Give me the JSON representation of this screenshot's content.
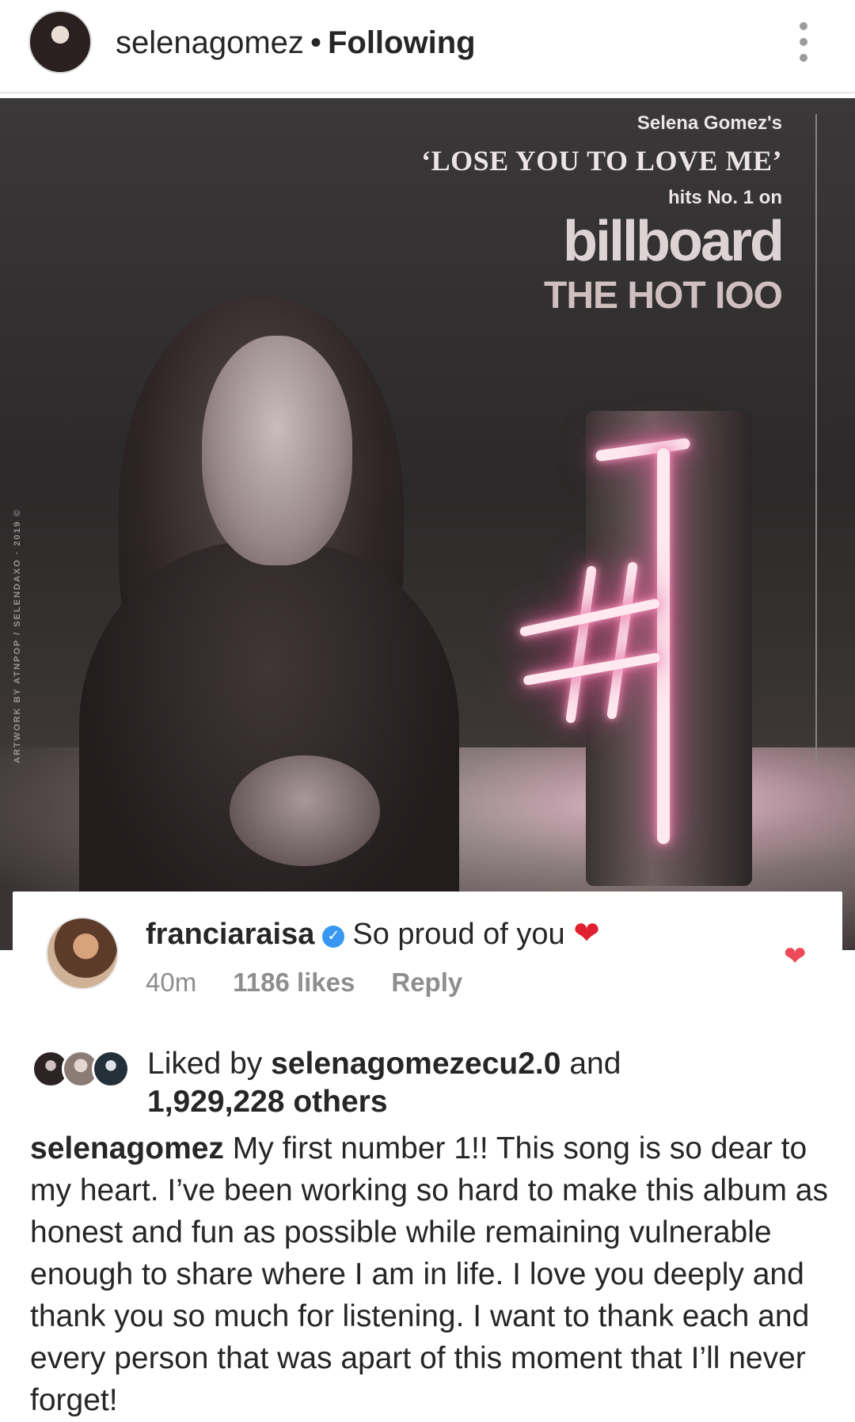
{
  "header": {
    "username": "selenagomez",
    "separator": "•",
    "follow_status": "Following"
  },
  "post_image": {
    "line1": "Selena Gomez's",
    "line2": "‘LOSE YOU TO LOVE ME’",
    "line3": "hits No. 1 on",
    "brand": "billboard",
    "chart": "THE HOT IOO",
    "credit": "ARTWORK BY ATNPOP / SELENDAXO · 2019 ©"
  },
  "comment": {
    "username": "franciaraisa",
    "verified_glyph": "✓",
    "text": "So proud of you",
    "emoji": "❤",
    "time": "40m",
    "likes": "1186 likes",
    "reply": "Reply"
  },
  "likes": {
    "prefix": "Liked by",
    "user": "selenagomezecu2.0",
    "connector": "and",
    "others": "1,929,228 others"
  },
  "caption": {
    "username": "selenagomez",
    "text": "My first number 1!! This song is so dear to my heart. I’ve been working so hard to make this album as honest and fun as possible while remaining vulnerable enough to share where I am in life. I love you deeply and thank you so much for listening. I want to thank each and every person that was apart of this moment that I’ll never forget!"
  },
  "colors": {
    "verified": "#3897f0",
    "heart": "#ed4956",
    "muted": "#8e8e8e"
  }
}
